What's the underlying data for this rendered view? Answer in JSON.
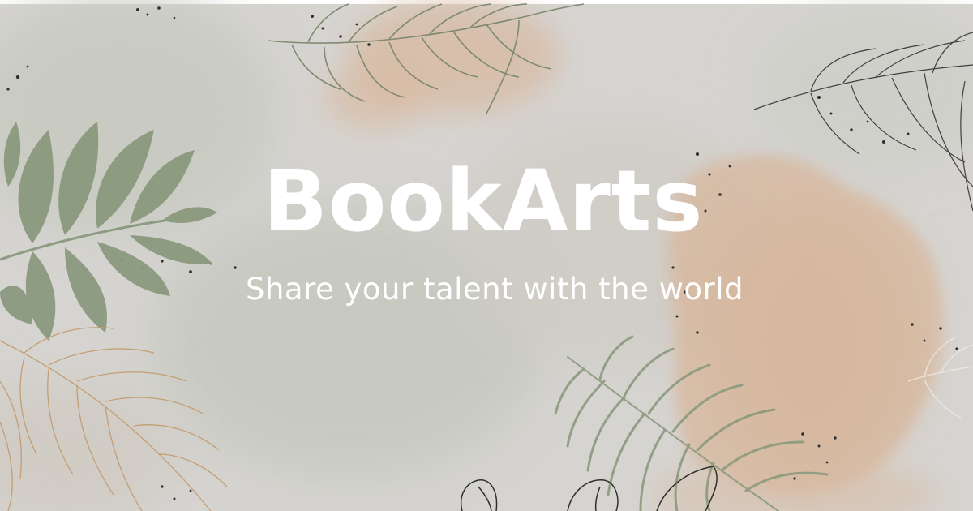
{
  "banner": {
    "title": "BookArts",
    "subtitle": "Share your talent with the world"
  },
  "icons": {
    "top_left_fern": "fern-leaf-icon",
    "top_center_fern": "palm-frond-outline-icon",
    "top_right_fern": "palm-frond-outline-icon",
    "bottom_left_fern": "fern-outline-icon",
    "bottom_right_fern": "palm-frond-icon",
    "bottom_monstera": "monstera-outline-icon"
  },
  "colors": {
    "background": "#d6d4d1",
    "sage": "#8a9a7e",
    "peach": "#d9b79c",
    "outline_tan": "#c29a6c",
    "outline_dark": "#3a3a3a",
    "text": "#ffffff"
  }
}
